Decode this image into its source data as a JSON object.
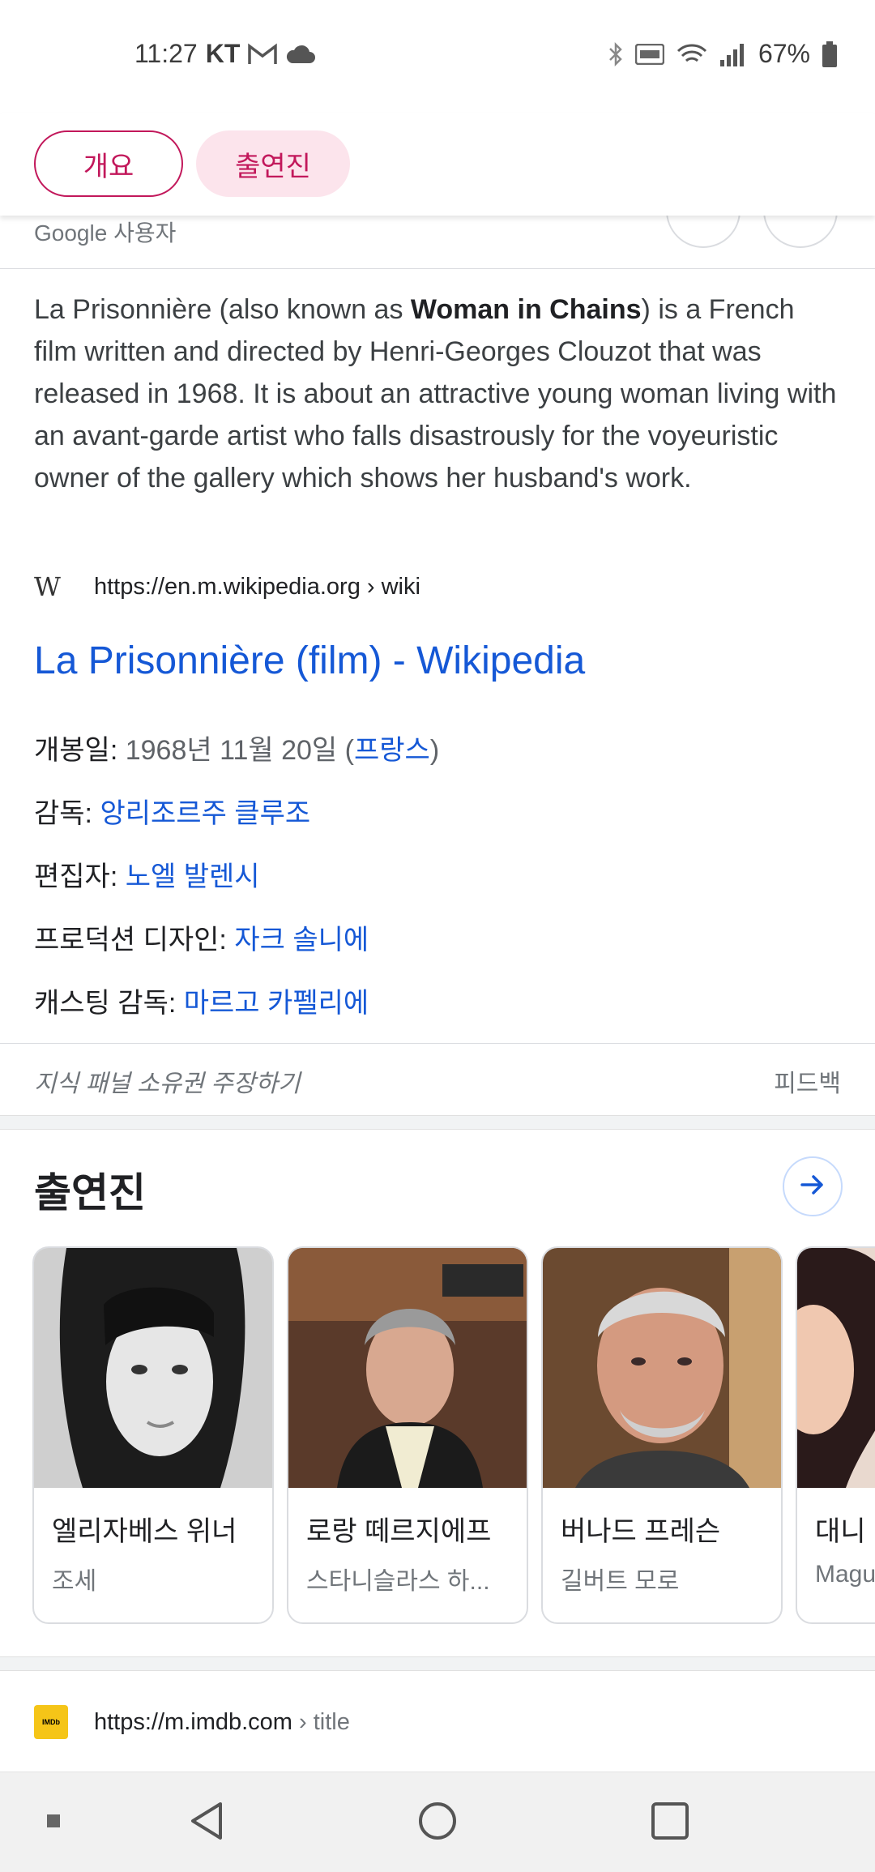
{
  "status_bar": {
    "time": "11:27",
    "carrier": "KT",
    "battery": "67%",
    "icons": [
      "gmail-icon",
      "cloud-icon",
      "bluetooth-icon",
      "nfc-icon",
      "wifi-icon",
      "signal-icon",
      "battery-icon"
    ]
  },
  "chips": {
    "overview": "개요",
    "cast": "출연진"
  },
  "user_row": {
    "label": "Google 사용자"
  },
  "description": {
    "before_bold": "La Prisonnière (also known as ",
    "bold": "Woman in Chains",
    "after_bold": ") is a French film written and directed by Henri-Georges Clouzot that was released in 1968. It is about an attractive young woman living with an avant-garde artist who falls disastrously for the voyeuristic owner of the gallery which shows her husband's work."
  },
  "source": {
    "logo_text": "W",
    "url": "https://en.m.wikipedia.org › wiki"
  },
  "result_title": "La Prisonnière (film) - Wikipedia",
  "facts": {
    "release": {
      "label": "개봉일: ",
      "value": "1968년 11월 20일 (",
      "link": "프랑스",
      "suffix": ")"
    },
    "director": {
      "label": "감독: ",
      "link": "앙리조르주 클루조"
    },
    "editor": {
      "label": "편집자: ",
      "link": "노엘 발렌시"
    },
    "production_design": {
      "label": "프로덕션 디자인: ",
      "link": "자크 솔니에"
    },
    "casting": {
      "label": "캐스팅 감독: ",
      "link": "마르고 카펠리에"
    }
  },
  "panel_footer": {
    "claim": "지식 패널 소유권 주장하기",
    "feedback": "피드백"
  },
  "cast_section": {
    "heading": "출연진",
    "cards": [
      {
        "name": "엘리자베스 위너",
        "role": "조세"
      },
      {
        "name": "로랑 떼르지에프",
        "role": "스타니슬라스 하..."
      },
      {
        "name": "버나드 프레슨",
        "role": "길버트 모로"
      },
      {
        "name": "대니",
        "role": "Magu"
      }
    ]
  },
  "imdb": {
    "logo_text": "IMDb",
    "url": "https://m.imdb.com",
    "crumb": " › title"
  },
  "colors": {
    "accent_pink": "#c2185b",
    "link_blue": "#1558d6"
  }
}
